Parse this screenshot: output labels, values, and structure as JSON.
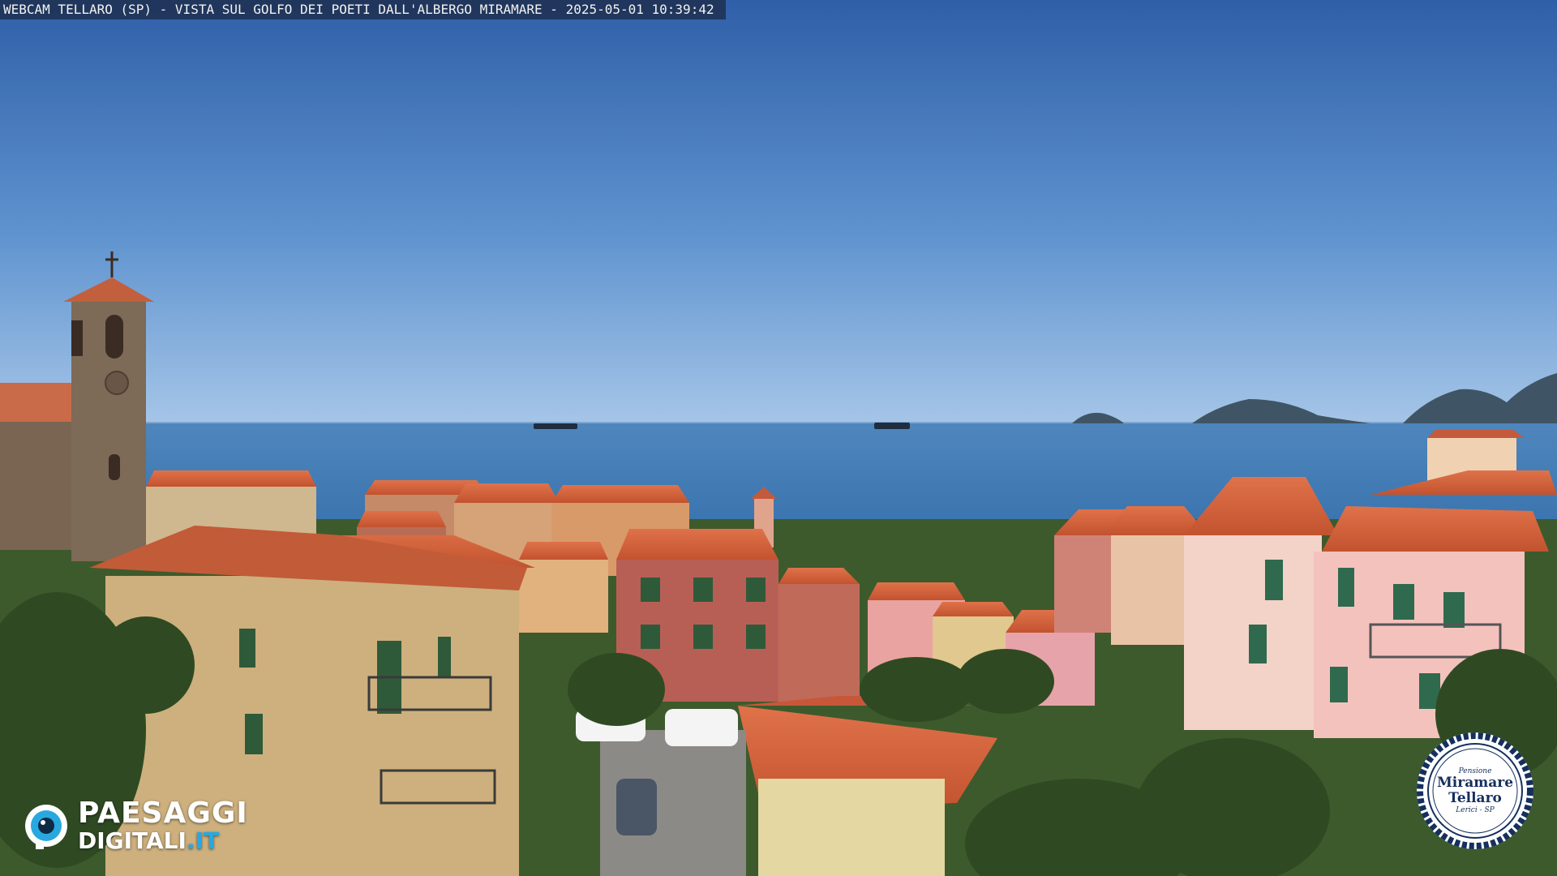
{
  "overlay": {
    "caption": "WEBCAM TELLARO (SP) - VISTA SUL GOLFO DEI POETI DALL'ALBERGO MIRAMARE - 2025-05-01 10:39:42"
  },
  "logo": {
    "line1": "PAESAGGI",
    "line2_main": "DIGITALI",
    "line2_tld": ".IT",
    "accent_color": "#29a8e0"
  },
  "badge": {
    "top_small": "Pensione",
    "name_line1": "Miramare",
    "name_line2": "Tellaro",
    "bottom_small": "Lerici - SP",
    "ring_color": "#15305e"
  },
  "colors": {
    "sky_top": "#2f5fa8",
    "sky_horizon": "#9cc0e6",
    "sea": "#3f78b2",
    "roof": "#d8643f",
    "vegetation": "#3d5a2c"
  }
}
